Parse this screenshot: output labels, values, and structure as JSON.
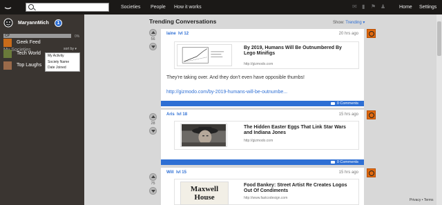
{
  "topbar": {
    "search_placeholder": "",
    "nav": [
      "Societies",
      "People",
      "How it works"
    ],
    "right_nav": [
      "Home",
      "Settings"
    ]
  },
  "sidebar": {
    "username": "MaryannMich",
    "notification_count": "1",
    "cp_label": "CP",
    "cp_value": "0%",
    "cp_progress": 0.0,
    "my_societies": "My Societies",
    "sort_by": "sort by",
    "sort_menu": [
      "My Activity",
      "Society Name",
      "Date Joined"
    ],
    "societies": [
      {
        "label": "Geek Feed",
        "color": "#c96b1a"
      },
      {
        "label": "Tech World",
        "color": "#6a7a3a"
      },
      {
        "label": "Top Laughs",
        "color": "#9a6a4a"
      }
    ]
  },
  "feed": {
    "title": "Trending Conversations",
    "show_label": "Show:",
    "show_value": "Trending"
  },
  "posts": [
    {
      "user": "laine",
      "level": "lvl 12",
      "time": "20 hrs ago",
      "votes": "56",
      "link_title": "By 2019, Humans Will Be Outnumbered By Lego Minifigs",
      "link_url": "http://gizmodo.com",
      "text": "They're taking over. And they don't even have opposible thumbs!",
      "url": "http://gizmodo.com/by-2019-humans-will-be-outnumbe...",
      "comments": "0 Comments"
    },
    {
      "user": "Aris",
      "level": "lvl 18",
      "time": "15 hrs ago",
      "votes": "28",
      "link_title": "The Hidden Easter Eggs That Link Star Wars and Indiana Jones",
      "link_url": "http://gizmodo.com",
      "comments": "0 Comments"
    },
    {
      "user": "Will",
      "level": "lvl 15",
      "time": "15 hrs ago",
      "votes": "75",
      "link_title": "Food Bankey: Street Artist Re Creates Logos Out Of Condiments",
      "link_url": "http://www.fastcodesign.com",
      "thumb_text_1": "Maxwell",
      "thumb_text_2": "House"
    }
  ],
  "footer": {
    "privacy": "Privacy",
    "separator": "•",
    "terms": "Terms"
  },
  "colors": {
    "accent": "#2e6fd4",
    "topbar": "#1b1917",
    "sidebar": "#3a3531",
    "society_icon": "#e06a10"
  }
}
